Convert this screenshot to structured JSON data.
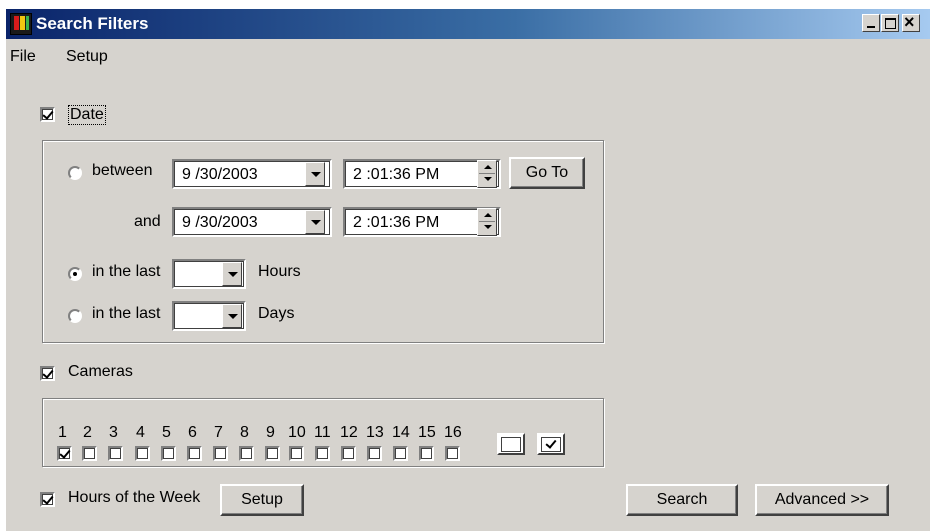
{
  "window": {
    "title": "Search Filters"
  },
  "menu": [
    "File",
    "Setup"
  ],
  "date": {
    "label": "Date",
    "checked": true,
    "between_label": "between",
    "and_label": "and",
    "start_date": "9 /30/2003",
    "start_time": "2 :01:36 PM",
    "end_date": "9 /30/2003",
    "end_time": "2 :01:36 PM",
    "goto_label": "Go To",
    "last_hours_label": "in the last",
    "hours_unit": "Hours",
    "last_days_label": "in the last",
    "days_unit": "Days",
    "hours_value": "",
    "days_value": "",
    "selected_option": "last_hours"
  },
  "cameras": {
    "label": "Cameras",
    "checked": true,
    "numbers": [
      "1",
      "2",
      "3",
      "4",
      "5",
      "6",
      "7",
      "8",
      "9",
      "10",
      "11",
      "12",
      "13",
      "14",
      "15",
      "16"
    ],
    "checked_list": [
      true,
      false,
      false,
      false,
      false,
      false,
      false,
      false,
      false,
      false,
      false,
      false,
      false,
      false,
      false,
      false
    ]
  },
  "hours_of_week": {
    "label": "Hours of the Week",
    "checked": true,
    "setup_label": "Setup"
  },
  "buttons": {
    "search": "Search",
    "advanced": "Advanced >>"
  }
}
